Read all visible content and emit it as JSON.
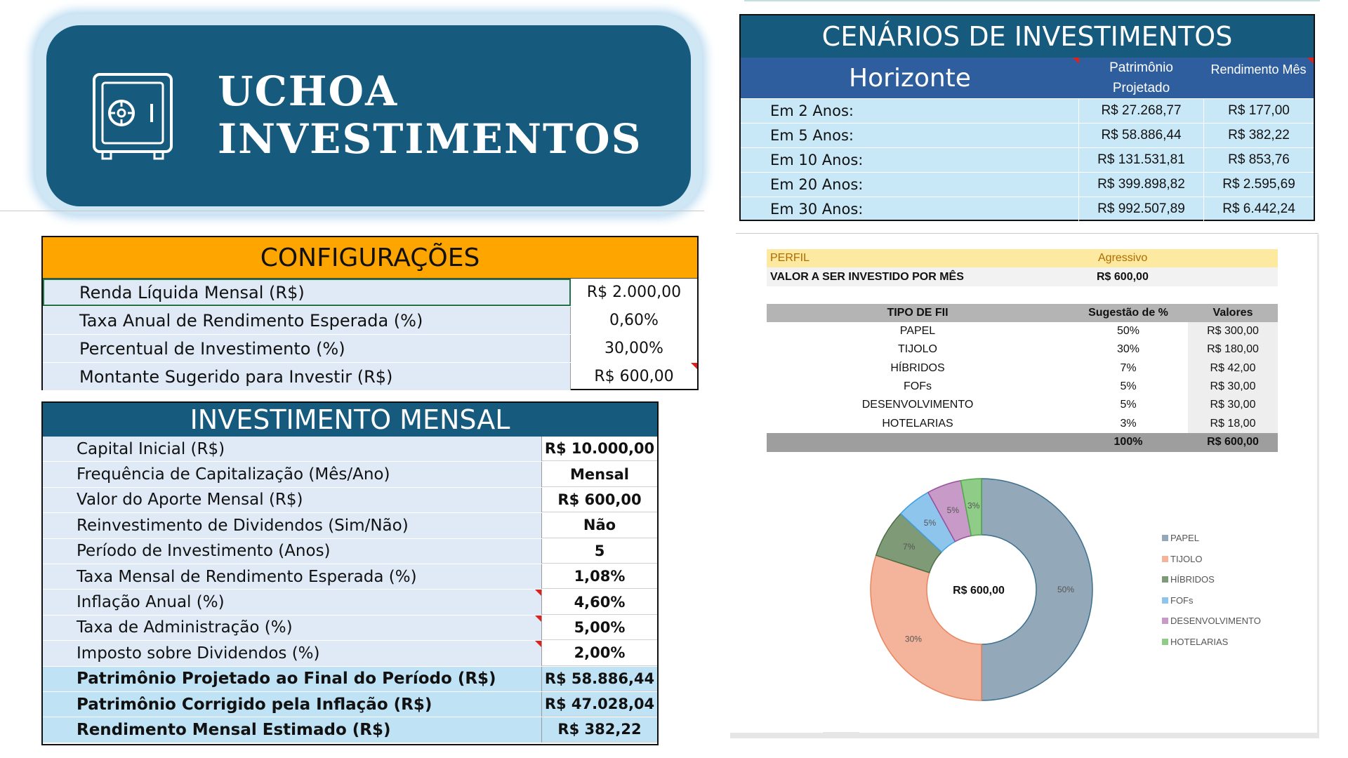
{
  "banner": {
    "line1": "UCHOA",
    "line2": "INVESTIMENTOS",
    "icon": "safe-icon"
  },
  "config": {
    "title": "CONFIGURAÇÕES",
    "rows": [
      {
        "label": "Renda Líquida Mensal (R$)",
        "value": "R$ 2.000,00"
      },
      {
        "label": "Taxa Anual de Rendimento Esperada (%)",
        "value": "0,60%"
      },
      {
        "label": "Percentual de Investimento (%)",
        "value": "30,00%"
      },
      {
        "label": "Montante Sugerido para Investir (R$)",
        "value": "R$ 600,00"
      }
    ]
  },
  "mensal": {
    "title": "INVESTIMENTO MENSAL",
    "rows": [
      {
        "label": "Capital Inicial (R$)",
        "value": "R$ 10.000,00"
      },
      {
        "label": "Frequência de Capitalização (Mês/Ano)",
        "value": "Mensal"
      },
      {
        "label": "Valor do Aporte Mensal (R$)",
        "value": "R$ 600,00"
      },
      {
        "label": "Reinvestimento de Dividendos (Sim/Não)",
        "value": "Não"
      },
      {
        "label": "Período de Investimento (Anos)",
        "value": "5"
      },
      {
        "label": "Taxa Mensal de Rendimento Esperada (%)",
        "value": "1,08%"
      },
      {
        "label": "Inflação Anual (%)",
        "value": "4,60%"
      },
      {
        "label": "Taxa de Administração (%)",
        "value": "5,00%"
      },
      {
        "label": "Imposto sobre Dividendos (%)",
        "value": "2,00%"
      },
      {
        "label": "Patrimônio Projetado ao Final do Período (R$)",
        "value": "R$ 58.886,44"
      },
      {
        "label": "Patrimônio Corrigido pela Inflação (R$)",
        "value": "R$ 47.028,04"
      },
      {
        "label": "Rendimento Mensal Estimado (R$)",
        "value": "R$ 382,22"
      }
    ]
  },
  "cenarios": {
    "title": "CENÁRIOS DE INVESTIMENTOS",
    "head": {
      "horizonte": "Horizonte",
      "patrimonio": "Patrimônio Projetado",
      "rendimento": "Rendimento Mês"
    },
    "rows": [
      {
        "label": "Em 2 Anos:",
        "patrimonio": "R$ 27.268,77",
        "rendimento": "R$ 177,00"
      },
      {
        "label": "Em 5 Anos:",
        "patrimonio": "R$ 58.886,44",
        "rendimento": "R$ 382,22"
      },
      {
        "label": "Em 10 Anos:",
        "patrimonio": "R$ 131.531,81",
        "rendimento": "R$ 853,76"
      },
      {
        "label": "Em 20 Anos:",
        "patrimonio": "R$ 399.898,82",
        "rendimento": "R$ 2.595,69"
      },
      {
        "label": "Em 30 Anos:",
        "patrimonio": "R$ 992.507,89",
        "rendimento": "R$ 6.442,24"
      }
    ]
  },
  "perfil": {
    "label": "PERFIL",
    "value": "Agressivo"
  },
  "valor_mes": {
    "label": "VALOR A SER INVESTIDO POR MÊS",
    "value": "R$ 600,00"
  },
  "fii": {
    "headers": {
      "tipo": "TIPO DE FII",
      "sugestao": "Sugestão de %",
      "valores": "Valores"
    },
    "rows": [
      {
        "tipo": "PAPEL",
        "sugestao": "50%",
        "valor": "R$ 300,00"
      },
      {
        "tipo": "TIJOLO",
        "sugestao": "30%",
        "valor": "R$ 180,00"
      },
      {
        "tipo": "HÍBRIDOS",
        "sugestao": "7%",
        "valor": "R$ 42,00"
      },
      {
        "tipo": "FOFs",
        "sugestao": "5%",
        "valor": "R$ 30,00"
      },
      {
        "tipo": "DESENVOLVIMENTO",
        "sugestao": "5%",
        "valor": "R$ 30,00"
      },
      {
        "tipo": "HOTELARIAS",
        "sugestao": "3%",
        "valor": "R$ 18,00"
      }
    ],
    "total": {
      "sugestao": "100%",
      "valor": "R$ 600,00"
    }
  },
  "chart_data": {
    "type": "pie",
    "center_label": "R$ 600,00",
    "categories": [
      "PAPEL",
      "TIJOLO",
      "HÍBRIDOS",
      "FOFs",
      "DESENVOLVIMENTO",
      "HOTELARIAS"
    ],
    "values": [
      50,
      30,
      7,
      5,
      5,
      3
    ],
    "labels": [
      "50%",
      "30%",
      "7%",
      "5%",
      "5%",
      "3%"
    ],
    "colors": [
      "#93a8b8",
      "#f4b49b",
      "#7f9a76",
      "#8ec5ec",
      "#c79ac8",
      "#8fcc88"
    ],
    "legend": "right"
  },
  "colors": {
    "header_blue": "#165a7d",
    "config_orange": "#ffa500",
    "row_blue": "#dfeaf6",
    "note_red": "#e0201a"
  }
}
